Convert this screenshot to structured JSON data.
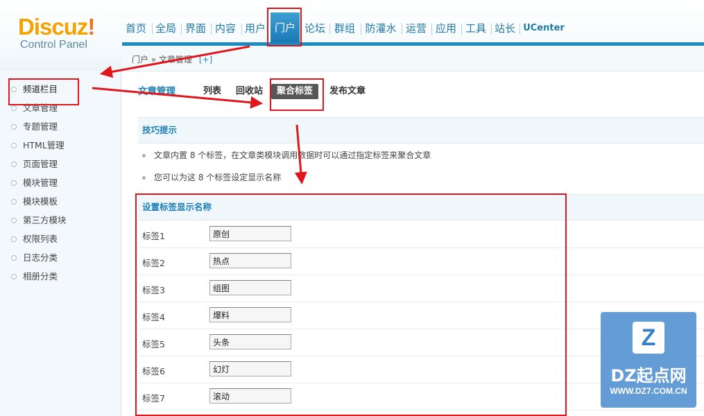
{
  "logo": {
    "brand": "Discuz",
    "mark": "!",
    "subtitle": "Control Panel"
  },
  "nav": [
    {
      "label": "首页"
    },
    {
      "label": "全局"
    },
    {
      "label": "界面"
    },
    {
      "label": "内容"
    },
    {
      "label": "用户"
    },
    {
      "label": "门户",
      "active": true
    },
    {
      "label": "论坛"
    },
    {
      "label": "群组"
    },
    {
      "label": "防灌水"
    },
    {
      "label": "运营"
    },
    {
      "label": "应用"
    },
    {
      "label": "工具"
    },
    {
      "label": "站长"
    },
    {
      "label": "UCenter"
    }
  ],
  "breadcrumb": {
    "text": "门户 » 文章管理",
    "add": "[+]"
  },
  "sidebar": {
    "items": [
      {
        "label": "频道栏目"
      },
      {
        "label": "文章管理"
      },
      {
        "label": "专题管理"
      },
      {
        "label": "HTML管理"
      },
      {
        "label": "页面管理"
      },
      {
        "label": "模块管理"
      },
      {
        "label": "模块模板"
      },
      {
        "label": "第三方模块"
      },
      {
        "label": "权限列表"
      },
      {
        "label": "日志分类"
      },
      {
        "label": "相册分类"
      }
    ]
  },
  "subnav": {
    "title": "文章管理",
    "tabs": [
      {
        "label": "列表"
      },
      {
        "label": "回收站"
      },
      {
        "label": "聚合标签",
        "active": true
      },
      {
        "label": "发布文章"
      }
    ]
  },
  "tips": {
    "heading": "技巧提示",
    "items": [
      "文章内置 8 个标签，在文章类模块调用数据时可以通过指定标签来聚合文章",
      "您可以为这 8 个标签设定显示名称"
    ]
  },
  "form": {
    "heading": "设置标签显示名称",
    "rows": [
      {
        "label": "标签1",
        "value": "原创"
      },
      {
        "label": "标签2",
        "value": "热点"
      },
      {
        "label": "标签3",
        "value": "组图"
      },
      {
        "label": "标签4",
        "value": "爆料"
      },
      {
        "label": "标签5",
        "value": "头条"
      },
      {
        "label": "标签6",
        "value": "幻灯"
      },
      {
        "label": "标签7",
        "value": "滚动"
      }
    ]
  },
  "watermark": {
    "mark": "Z",
    "title": "DZ起点网",
    "url": "WWW.DZ7.COM.CN"
  },
  "colors": {
    "accent": "#1b8bc4",
    "annotation": "#e0161c",
    "active_tab": "#575757"
  }
}
